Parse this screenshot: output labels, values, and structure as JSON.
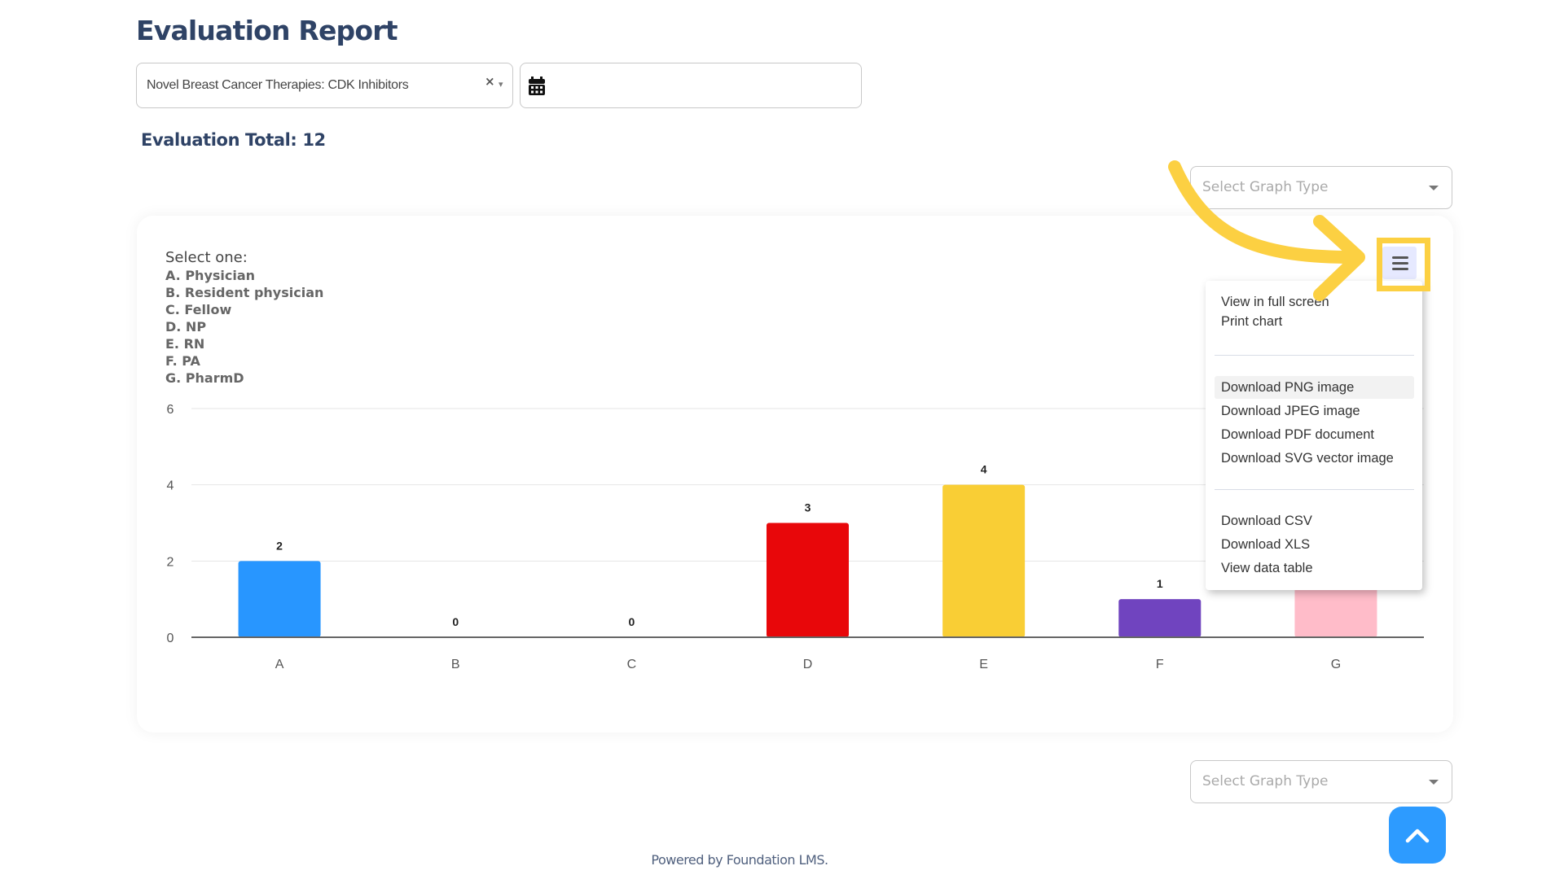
{
  "header": {
    "title": "Evaluation Report",
    "course_select": {
      "value": "Novel Breast Cancer Therapies: CDK Inhibitors",
      "clear_icon": "×",
      "caret_icon": "▾"
    },
    "date_input": {
      "value": "",
      "icon": "calendar-icon"
    }
  },
  "summary": {
    "total_label": "Evaluation Total: 12"
  },
  "graph_type_select_top": {
    "placeholder": "Select Graph Type"
  },
  "graph_type_select_bottom": {
    "placeholder": "Select Graph Type"
  },
  "question": {
    "prompt": "Select one:",
    "options": [
      "A. Physician",
      "B. Resident physician",
      "C. Fellow",
      "D. NP",
      "E. RN",
      "F. PA",
      "G. PharmD"
    ]
  },
  "chart_menu": {
    "button_icon": "hamburger-menu-icon",
    "items": [
      {
        "label": "View in full screen"
      },
      {
        "label": "Print chart"
      },
      {
        "separator": true
      },
      {
        "label": "Download PNG image",
        "hovered": true
      },
      {
        "label": "Download JPEG image"
      },
      {
        "label": "Download PDF document"
      },
      {
        "label": "Download SVG vector image"
      },
      {
        "separator": true
      },
      {
        "label": "Download CSV"
      },
      {
        "label": "Download XLS"
      },
      {
        "label": "View data table"
      }
    ]
  },
  "annotation": {
    "color": "#fcd042",
    "type": "curved-arrow-pointing-to-menu"
  },
  "chart_data": {
    "type": "bar",
    "title": "",
    "xlabel": "",
    "ylabel": "",
    "categories": [
      "A",
      "B",
      "C",
      "D",
      "E",
      "F",
      "G"
    ],
    "values": [
      2,
      0,
      0,
      3,
      4,
      1,
      2
    ],
    "value_labels_visible": [
      "2",
      "0",
      "0",
      "3",
      "4",
      "1",
      null
    ],
    "colors": [
      "#2896ff",
      "#2896ff",
      "#2896ff",
      "#e8070a",
      "#f9ce35",
      "#7044bf",
      "#ffbcc9"
    ],
    "yticks": [
      0,
      2,
      4,
      6
    ],
    "ylim": [
      0,
      6
    ],
    "grid": true,
    "legend": "none"
  },
  "scroll_top_button": {
    "icon": "chevron-up-icon"
  },
  "footer": {
    "text": "Powered by Foundation LMS."
  }
}
